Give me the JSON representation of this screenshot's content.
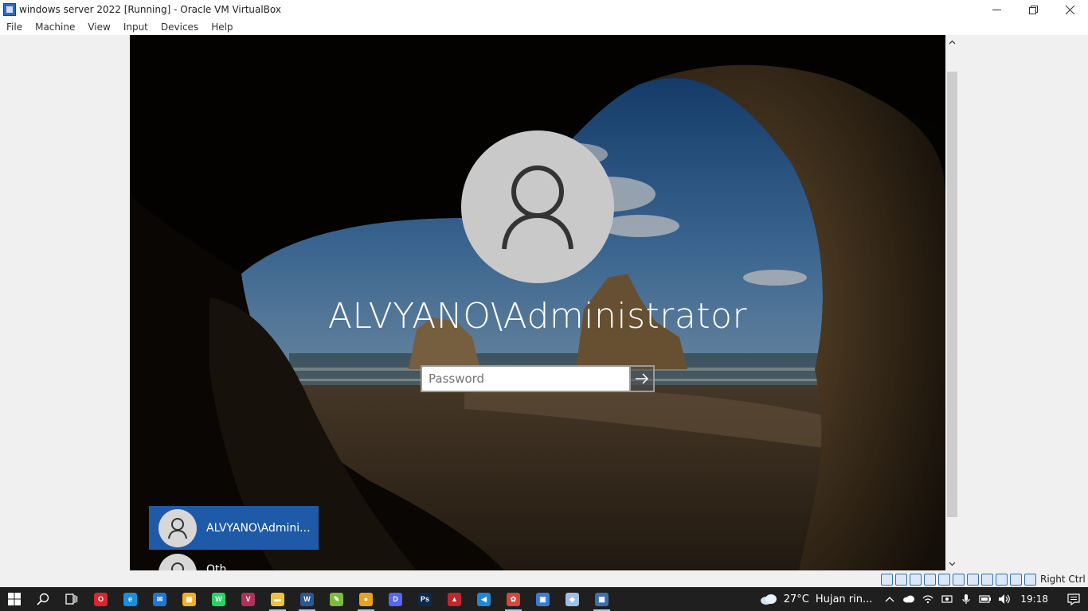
{
  "window": {
    "title": "windows server 2022 [Running] - Oracle VM VirtualBox",
    "controls": [
      "minimize-icon",
      "restore-icon",
      "close-icon"
    ]
  },
  "menubar": {
    "items": [
      "File",
      "Machine",
      "View",
      "Input",
      "Devices",
      "Help"
    ]
  },
  "login": {
    "username": "ALVYANO\\Administrator",
    "password_placeholder": "Password",
    "submit_icon": "arrow-right-icon"
  },
  "user_list": [
    {
      "label": "ALVYANO\\Admini...",
      "selected": true
    },
    {
      "label": "Oth",
      "selected": false
    }
  ],
  "vbox_status": {
    "host_key": "Right Ctrl"
  },
  "taskbar": {
    "apps": [
      {
        "name": "opera",
        "glyph": "O",
        "color": "#d8262f",
        "running": false
      },
      {
        "name": "edge",
        "glyph": "e",
        "color": "#1d8fd8",
        "running": false
      },
      {
        "name": "mail",
        "glyph": "✉",
        "color": "#1e78d2",
        "running": false
      },
      {
        "name": "store",
        "glyph": "▦",
        "color": "#f2b01e",
        "running": false
      },
      {
        "name": "whatsapp",
        "glyph": "W",
        "color": "#25d366",
        "running": false
      },
      {
        "name": "app-v",
        "glyph": "V",
        "color": "#b0315b",
        "running": false
      },
      {
        "name": "file-explorer",
        "glyph": "▬",
        "color": "#f0c13b",
        "running": true
      },
      {
        "name": "word",
        "glyph": "W",
        "color": "#2b5797",
        "running": true
      },
      {
        "name": "app-green",
        "glyph": "✎",
        "color": "#7dbb3b",
        "running": false
      },
      {
        "name": "chrome",
        "glyph": "●",
        "color": "#e8a21f",
        "running": true
      },
      {
        "name": "discord",
        "glyph": "D",
        "color": "#5865f2",
        "running": false
      },
      {
        "name": "photoshop",
        "glyph": "Ps",
        "color": "#0d2a4d",
        "running": false
      },
      {
        "name": "app-red",
        "glyph": "▲",
        "color": "#c0282e",
        "running": false
      },
      {
        "name": "vscode",
        "glyph": "◀",
        "color": "#1f86d8",
        "running": false
      },
      {
        "name": "app-paint",
        "glyph": "✿",
        "color": "#d5473b",
        "running": true
      },
      {
        "name": "app-blue",
        "glyph": "▣",
        "color": "#3a7bd5",
        "running": false
      },
      {
        "name": "app-cube",
        "glyph": "◆",
        "color": "#9fbfe3",
        "running": false
      },
      {
        "name": "virtualbox",
        "glyph": "▩",
        "color": "#3f6ea8",
        "running": true
      }
    ],
    "weather": {
      "temp": "27°C",
      "desc": "Hujan rin..."
    },
    "clock": "19:18"
  }
}
